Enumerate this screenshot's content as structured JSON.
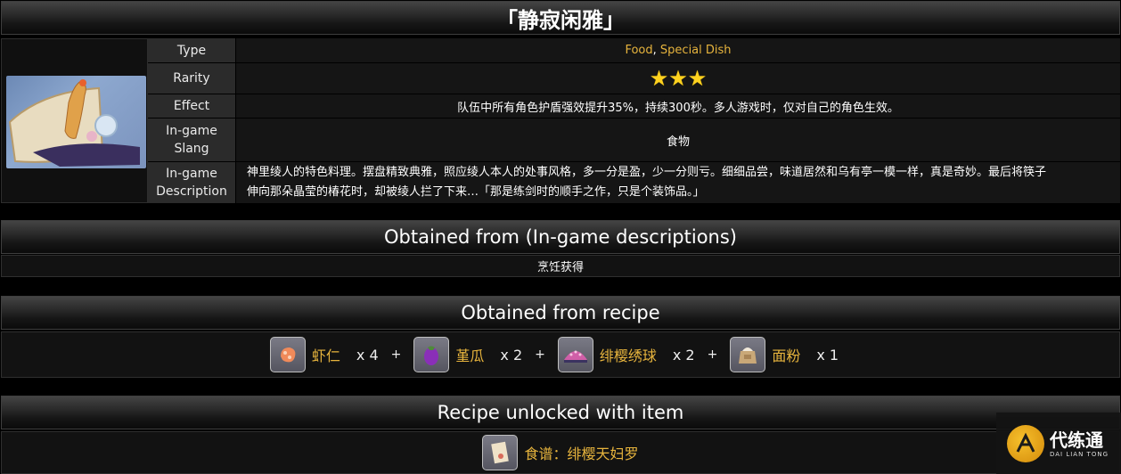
{
  "title": "「静寂闲雅」",
  "info": {
    "type_label": "Type",
    "type_value_1": "Food",
    "type_sep": ",",
    "type_value_2": "Special Dish",
    "rarity_label": "Rarity",
    "rarity_stars": 3,
    "effect_label": "Effect",
    "effect_value": "队伍中所有角色护盾强效提升35%，持续300秒。多人游戏时，仅对自己的角色生效。",
    "slang_label_1": "In-game",
    "slang_label_2": "Slang",
    "slang_value": "食物",
    "desc_label_1": "In-game",
    "desc_label_2": "Description",
    "desc_value_1": "神里绫人的特色料理。摆盘精致典雅，照应绫人本人的处事风格，多一分是盈，少一分则亏。细细品尝，味道居然和乌有亭一模一样，真是奇妙。最后将筷子",
    "desc_value_2": "伸向那朵晶莹的椿花时，却被绫人拦了下来…「那是练剑时的顺手之作，只是个装饰品。」"
  },
  "obtained": {
    "heading": "Obtained from (In-game descriptions)",
    "value": "烹饪获得"
  },
  "recipe": {
    "heading": "Obtained from recipe",
    "ingredients": [
      {
        "name": "虾仁",
        "qty": "x 4",
        "icon": "shrimp-icon"
      },
      {
        "name": "堇瓜",
        "qty": "x 2",
        "icon": "eggplant-icon"
      },
      {
        "name": "绯樱绣球",
        "qty": "x 2",
        "icon": "sakura-bloom-icon"
      },
      {
        "name": "面粉",
        "qty": "x 1",
        "icon": "flour-sack-icon"
      }
    ],
    "plus": "+"
  },
  "unlock": {
    "heading": "Recipe unlocked with item",
    "item_label": "食谱：绯樱天妇罗",
    "icon": "recipe-scroll-icon"
  },
  "watermark": {
    "main": "代练通",
    "sub": "DAI LIAN TONG"
  },
  "colors": {
    "accent_gold": "#e7b43d",
    "star": "#ffd21f"
  }
}
